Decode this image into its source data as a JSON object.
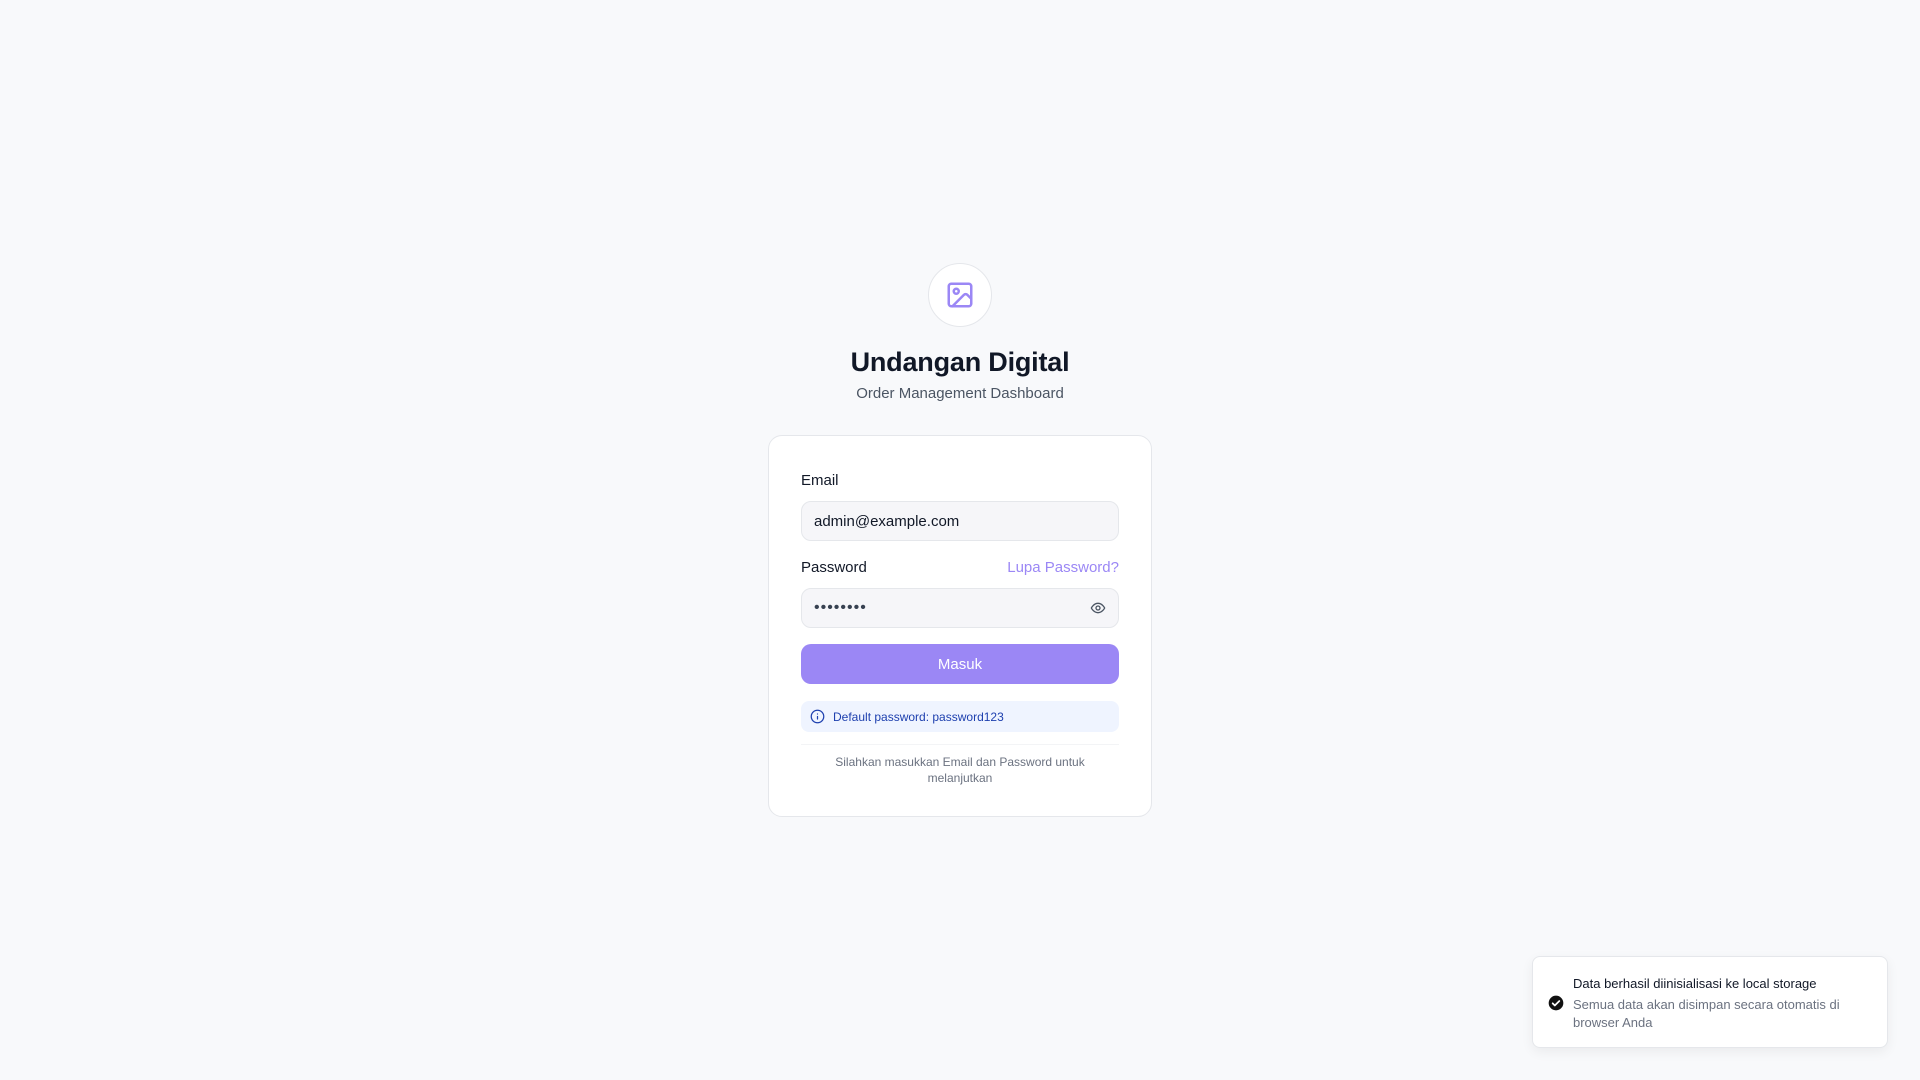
{
  "brand": {
    "title": "Undangan Digital",
    "subtitle": "Order Management Dashboard",
    "logo_icon": "image-icon",
    "accent_color": "#9b87f5"
  },
  "form": {
    "email_label": "Email",
    "email_value": "admin@example.com",
    "password_label": "Password",
    "forgot_label": "Lupa Password?",
    "password_masked": "••••••••",
    "submit_label": "Masuk",
    "hint_text": "Default password: password123",
    "footer_text": "Silahkan masukkan Email dan Password untuk melanjutkan"
  },
  "toast": {
    "title": "Data berhasil diinisialisasi ke local storage",
    "description": "Semua data akan disimpan secara otomatis di browser Anda",
    "icon": "check-circle-icon"
  }
}
